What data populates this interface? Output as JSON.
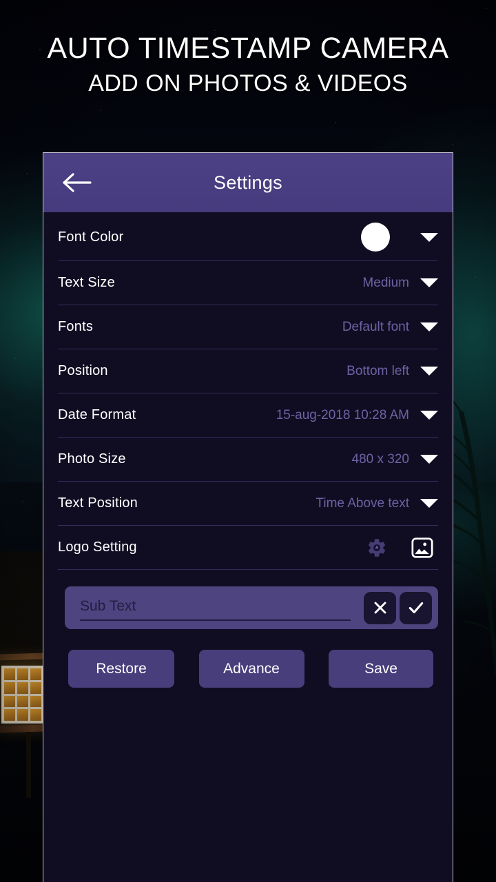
{
  "promo": {
    "line1": "AUTO TIMESTAMP CAMERA",
    "line2": "ADD ON PHOTOS & VIDEOS"
  },
  "appbar": {
    "title": "Settings",
    "back_icon": "arrow-left-icon"
  },
  "settings": {
    "rows": [
      {
        "label": "Font Color",
        "value": "",
        "control": "color-swatch",
        "swatch_color": "#ffffff",
        "caret": "chevron-down-icon"
      },
      {
        "label": "Text Size",
        "value": "Medium",
        "control": "dropdown",
        "caret": "chevron-down-icon"
      },
      {
        "label": "Fonts",
        "value": "Default font",
        "control": "dropdown",
        "caret": "chevron-down-icon"
      },
      {
        "label": "Position",
        "value": "Bottom left",
        "control": "dropdown",
        "caret": "chevron-down-icon"
      },
      {
        "label": "Date Format",
        "value": "15-aug-2018 10:28 AM",
        "control": "dropdown",
        "caret": "chevron-down-icon"
      },
      {
        "label": "Photo Size",
        "value": "480 x 320",
        "control": "dropdown",
        "caret": "chevron-down-icon"
      },
      {
        "label": "Text Position",
        "value": "Time Above text",
        "control": "dropdown",
        "caret": "chevron-down-icon"
      },
      {
        "label": "Logo Setting",
        "value": "",
        "control": "icons",
        "icons": [
          "gear-icon",
          "image-icon"
        ]
      }
    ]
  },
  "subtext": {
    "placeholder": "Sub Text",
    "value": "",
    "cancel_icon": "close-icon",
    "confirm_icon": "check-icon"
  },
  "actions": {
    "restore_label": "Restore",
    "advance_label": "Advance",
    "save_label": "Save"
  },
  "colors": {
    "accent_purple": "#4c4185",
    "panel_bg": "#100d22",
    "value_text": "#6e62a4",
    "separator": "#342a5c",
    "subtext_bar": "#4e4480",
    "button_bg": "#483e7c"
  }
}
